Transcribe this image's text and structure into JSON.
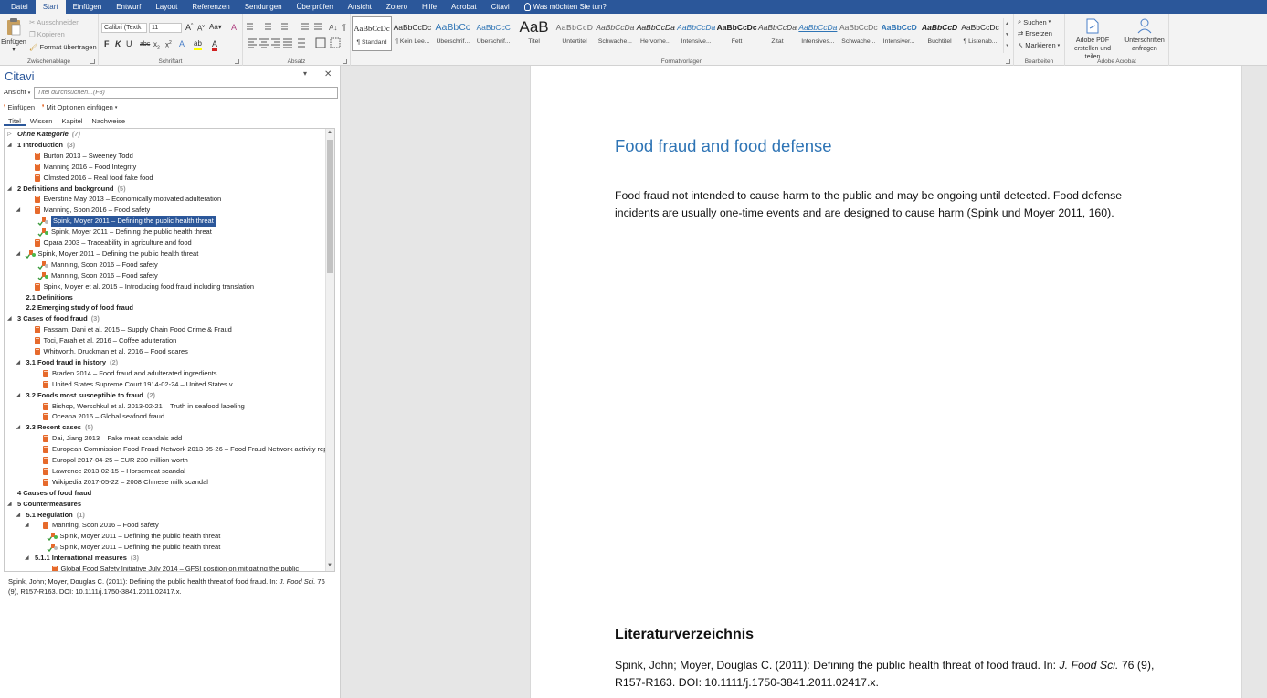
{
  "ribbon": {
    "tabs": [
      "Datei",
      "Start",
      "Einfügen",
      "Entwurf",
      "Layout",
      "Referenzen",
      "Sendungen",
      "Überprüfen",
      "Ansicht",
      "Zotero",
      "Hilfe",
      "Acrobat",
      "Citavi"
    ],
    "active_tab": "Start",
    "tell_me": "Was möchten Sie tun?",
    "clipboard": {
      "paste": "Einfügen",
      "cut": "Ausschneiden",
      "copy": "Kopieren",
      "format_painter": "Format übertragen",
      "label": "Zwischenablage"
    },
    "font": {
      "name": "Calibri (Textk",
      "size": "11",
      "label": "Schriftart"
    },
    "paragraph": {
      "label": "Absatz"
    },
    "styles": {
      "label": "Formatvorlagen",
      "items": [
        {
          "preview": "AaBbCcDc",
          "name": "¶ Standard"
        },
        {
          "preview": "AaBbCcDc",
          "name": "¶ Kein Lee..."
        },
        {
          "preview": "AaBbCc",
          "name": "Überschrif..."
        },
        {
          "preview": "AaBbCcC",
          "name": "Überschrif..."
        },
        {
          "preview": "AaB",
          "name": "Titel"
        },
        {
          "preview": "AaBbCcD",
          "name": "Untertitel"
        },
        {
          "preview": "AaBbCcDa",
          "name": "Schwache..."
        },
        {
          "preview": "AaBbCcDa",
          "name": "Hervorhe..."
        },
        {
          "preview": "AaBbCcDa",
          "name": "Intensive..."
        },
        {
          "preview": "AaBbCcDc",
          "name": "Fett"
        },
        {
          "preview": "AaBbCcDa",
          "name": "Zitat"
        },
        {
          "preview": "AaBbCcDa",
          "name": "Intensives..."
        },
        {
          "preview": "AaBbCcDc",
          "name": "Schwache..."
        },
        {
          "preview": "AaBbCcD",
          "name": "Intensiver..."
        },
        {
          "preview": "AaBbCcD",
          "name": "Buchtitel"
        },
        {
          "preview": "AaBbCcDc",
          "name": "¶ Listenab..."
        }
      ]
    },
    "editing": {
      "find": "Suchen",
      "replace": "Ersetzen",
      "select": "Markieren",
      "label": "Bearbeiten"
    },
    "acrobat": {
      "create_pdf": "Adobe PDF erstellen und teilen",
      "request_sign": "Unterschriften anfragen",
      "label": "Adobe Acrobat"
    },
    "colors": {
      "tab_bar": "#2b579a",
      "highlight": "#ffff00",
      "font_color": "#d02020"
    }
  },
  "citavi": {
    "title": "Citavi",
    "ansicht": "Ansicht",
    "search_placeholder": "Titel durchsuchen...(F8)",
    "insert": "Einfügen",
    "insert_options": "Mit Optionen einfügen",
    "tabs": [
      "Titel",
      "Wissen",
      "Kapitel",
      "Nachweise"
    ],
    "active_tab": "Titel",
    "tree": [
      {
        "level": 0,
        "arrow": "▷",
        "type": "category",
        "text": "Ohne Kategorie",
        "count": "(7)",
        "style": "italic"
      },
      {
        "level": 0,
        "arrow": "◢",
        "type": "category",
        "text": "1 Introduction",
        "count": "(3)"
      },
      {
        "level": 1,
        "type": "ref",
        "text": "Burton 2013 – Sweeney Todd"
      },
      {
        "level": 1,
        "type": "ref",
        "text": "Manning 2016 – Food Integrity"
      },
      {
        "level": 1,
        "type": "ref",
        "text": "Olmsted 2016 – Real food fake food"
      },
      {
        "level": 0,
        "arrow": "◢",
        "type": "category",
        "text": "2 Definitions and background",
        "count": "(5)"
      },
      {
        "level": 1,
        "type": "ref",
        "text": "Everstine May 2013 – Economically motivated adulteration"
      },
      {
        "level": 1,
        "arrow": "◢",
        "type": "ref",
        "text": "Manning, Soon 2016 – Food safety"
      },
      {
        "level": 2,
        "type": "cite",
        "text": "Spink, Moyer 2011 – Defining the public health threat",
        "selected": true
      },
      {
        "level": 2,
        "type": "cite",
        "text": "Spink, Moyer 2011 – Defining the public health threat"
      },
      {
        "level": 1,
        "type": "ref",
        "text": "Opara 2003 – Traceability in agriculture and food"
      },
      {
        "level": 1,
        "arrow": "◢",
        "type": "cite",
        "text": "Spink, Moyer 2011 – Defining the public health threat"
      },
      {
        "level": 2,
        "type": "cite",
        "text": "Manning, Soon 2016 – Food safety"
      },
      {
        "level": 2,
        "type": "cite",
        "text": "Manning, Soon 2016 – Food safety"
      },
      {
        "level": 1,
        "type": "ref",
        "text": "Spink, Moyer et al. 2015 – Introducing food fraud including translation"
      },
      {
        "level": 1,
        "type": "category",
        "text": "2.1 Definitions"
      },
      {
        "level": 1,
        "type": "category",
        "text": "2.2 Emerging study of food fraud"
      },
      {
        "level": 0,
        "arrow": "◢",
        "type": "category",
        "text": "3 Cases of food fraud",
        "count": "(3)"
      },
      {
        "level": 1,
        "type": "ref",
        "text": "Fassam, Dani et al. 2015 – Supply Chain Food Crime & Fraud"
      },
      {
        "level": 1,
        "type": "ref",
        "text": "Toci, Farah et al. 2016 – Coffee adulteration"
      },
      {
        "level": 1,
        "type": "ref",
        "text": "Whitworth, Druckman et al. 2016 – Food scares"
      },
      {
        "level": 1,
        "arrow": "◢",
        "type": "category",
        "text": "3.1 Food fraud in history",
        "count": "(2)"
      },
      {
        "level": 2,
        "type": "ref",
        "text": "Braden 2014 – Food fraud and adulterated ingredients"
      },
      {
        "level": 2,
        "type": "ref",
        "text": "United States Supreme Court 1914-02-24 – United States v"
      },
      {
        "level": 1,
        "arrow": "◢",
        "type": "category",
        "text": "3.2 Foods most susceptible to fraud",
        "count": "(2)"
      },
      {
        "level": 2,
        "type": "ref",
        "text": "Bishop, Werschkul et al. 2013-02-21 – Truth in seafood labeling"
      },
      {
        "level": 2,
        "type": "ref",
        "text": "Oceana 2016 – Global seafood fraud"
      },
      {
        "level": 1,
        "arrow": "◢",
        "type": "category",
        "text": "3.3 Recent cases",
        "count": "(5)"
      },
      {
        "level": 2,
        "type": "ref",
        "text": "Dai, Jiang 2013 – Fake meat scandals add"
      },
      {
        "level": 2,
        "type": "ref",
        "text": "European Commission Food Fraud Network 2013-05-26 – Food Fraud Network activity report"
      },
      {
        "level": 2,
        "type": "ref",
        "text": "Europol 2017-04-25 – EUR 230 million worth"
      },
      {
        "level": 2,
        "type": "ref",
        "text": "Lawrence 2013-02-15 – Horsemeat scandal"
      },
      {
        "level": 2,
        "type": "ref",
        "text": "Wikipedia 2017-05-22 – 2008 Chinese milk scandal"
      },
      {
        "level": 0,
        "type": "category",
        "text": "4 Causes of food fraud"
      },
      {
        "level": 0,
        "arrow": "◢",
        "type": "category",
        "text": "5 Countermeasures"
      },
      {
        "level": 1,
        "arrow": "◢",
        "type": "category",
        "text": "5.1 Regulation",
        "count": "(1)"
      },
      {
        "level": 2,
        "arrow": "◢",
        "type": "ref",
        "text": "Manning, Soon 2016 – Food safety"
      },
      {
        "level": 3,
        "type": "cite",
        "text": "Spink, Moyer 2011 – Defining the public health threat"
      },
      {
        "level": 3,
        "type": "cite",
        "text": "Spink, Moyer 2011 – Defining the public health threat"
      },
      {
        "level": 2,
        "arrow": "◢",
        "type": "category",
        "text": "5.1.1 International measures",
        "count": "(3)"
      },
      {
        "level": 3,
        "type": "ref",
        "text": "Global Food Safety Initiative July 2014 – GFSI position on mitigating the public"
      }
    ],
    "preview": {
      "before": "Spink, John; Moyer, Douglas C. (2011): Defining the public health threat of food fraud. In: ",
      "journal": "J. Food Sci.",
      "after": " 76 (9), R157-R163. DOI: 10.1111/j.1750-3841.2011.02417.x."
    }
  },
  "document": {
    "heading": "Food fraud and food defense",
    "paragraph": "Food fraud not intended to cause harm to the public and may be ongoing until detected. Food defense incidents are usually one-time events and are designed to cause harm (Spink und Moyer 2011, 160).",
    "bibliography_heading": "Literaturverzeichnis",
    "bibliography_entry": {
      "before": "Spink, John; Moyer, Douglas C. (2011): Defining the public health threat of food fraud. In: ",
      "journal": "J. Food Sci.",
      "after": " 76 (9), R157-R163. DOI: 10.1111/j.1750-3841.2011.02417.x."
    }
  }
}
